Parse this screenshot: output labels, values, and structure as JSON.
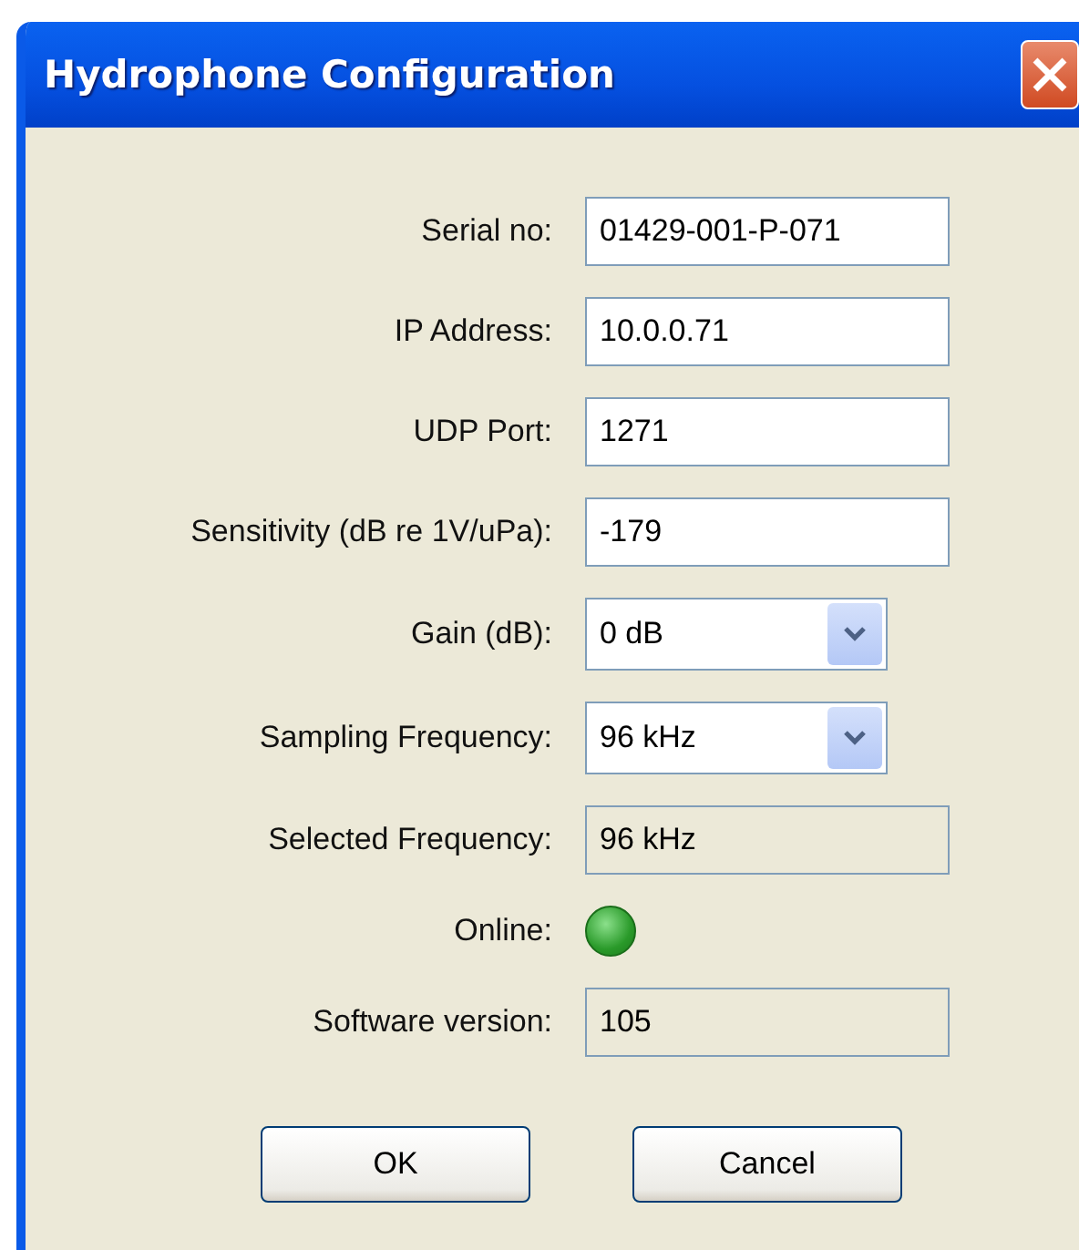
{
  "window": {
    "title": "Hydrophone Configuration"
  },
  "fields": [
    {
      "kind": "text",
      "label": "Serial no:",
      "value": "01429-001-P-071"
    },
    {
      "kind": "text",
      "label": "IP Address:",
      "value": "10.0.0.71"
    },
    {
      "kind": "text",
      "label": "UDP Port:",
      "value": "1271"
    },
    {
      "kind": "text",
      "label": "Sensitivity (dB re 1V/uPa):",
      "value": "-179"
    },
    {
      "kind": "select",
      "label": "Gain (dB):",
      "value": "0 dB"
    },
    {
      "kind": "select",
      "label": "Sampling Frequency:",
      "value": "96 kHz"
    },
    {
      "kind": "readonly",
      "label": "Selected Frequency:",
      "value": "96 kHz"
    },
    {
      "kind": "indicator",
      "label": "Online:",
      "on": true
    },
    {
      "kind": "readonly",
      "label": "Software version:",
      "value": "105"
    }
  ],
  "buttons": [
    "OK",
    "Cancel"
  ]
}
